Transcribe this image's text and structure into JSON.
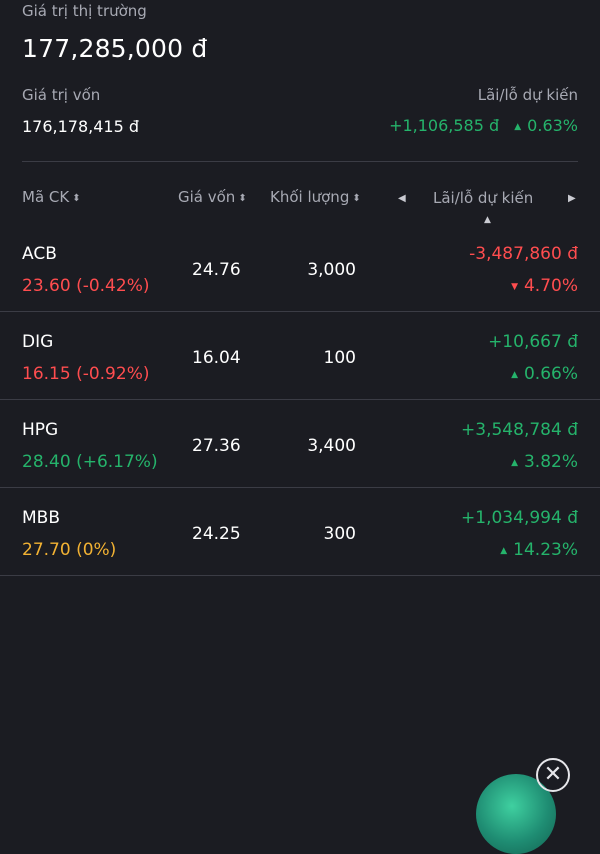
{
  "summary": {
    "market_label": "Giá trị thị trường",
    "market_value": "177,285,000 đ",
    "capital_label": "Giá trị vốn",
    "capital_value": "176,178,415 đ",
    "pl_label": "Lãi/lỗ dự kiến",
    "pl_value": "+1,106,585 đ",
    "pl_percent": "0.63%"
  },
  "table": {
    "headers": {
      "symbol": "Mã CK",
      "cost": "Giá vốn",
      "volume": "Khối lượng",
      "pl": "Lãi/lỗ dự kiến"
    },
    "rows": [
      {
        "symbol": "ACB",
        "price": "23.60 (-0.42%)",
        "price_color": "#ff4d4f",
        "cost": "24.76",
        "volume": "3,000",
        "pl_value": "-3,487,860 đ",
        "pl_percent": "4.70%",
        "pl_direction": "down",
        "pl_color": "#ff4d4f"
      },
      {
        "symbol": "DIG",
        "price": "16.15 (-0.92%)",
        "price_color": "#ff4d4f",
        "cost": "16.04",
        "volume": "100",
        "pl_value": "+10,667 đ",
        "pl_percent": "0.66%",
        "pl_direction": "up",
        "pl_color": "#25b36b"
      },
      {
        "symbol": "HPG",
        "price": "28.40 (+6.17%)",
        "price_color": "#25b36b",
        "cost": "27.36",
        "volume": "3,400",
        "pl_value": "+3,548,784 đ",
        "pl_percent": "3.82%",
        "pl_direction": "up",
        "pl_color": "#25b36b"
      },
      {
        "symbol": "MBB",
        "price": "27.70 (0%)",
        "price_color": "#f2b233",
        "cost": "24.25",
        "volume": "300",
        "pl_value": "+1,034,994 đ",
        "pl_percent": "14.23%",
        "pl_direction": "up",
        "pl_color": "#25b36b"
      }
    ]
  },
  "icons": {
    "sort": "sort-icon",
    "prev": "chevron-left-icon",
    "next": "chevron-right-icon",
    "close": "close-icon"
  },
  "colors": {
    "background": "#1b1c22",
    "up": "#25b36b",
    "down": "#ff4d4f",
    "reference": "#f2b233",
    "muted": "#a7a9b3"
  }
}
